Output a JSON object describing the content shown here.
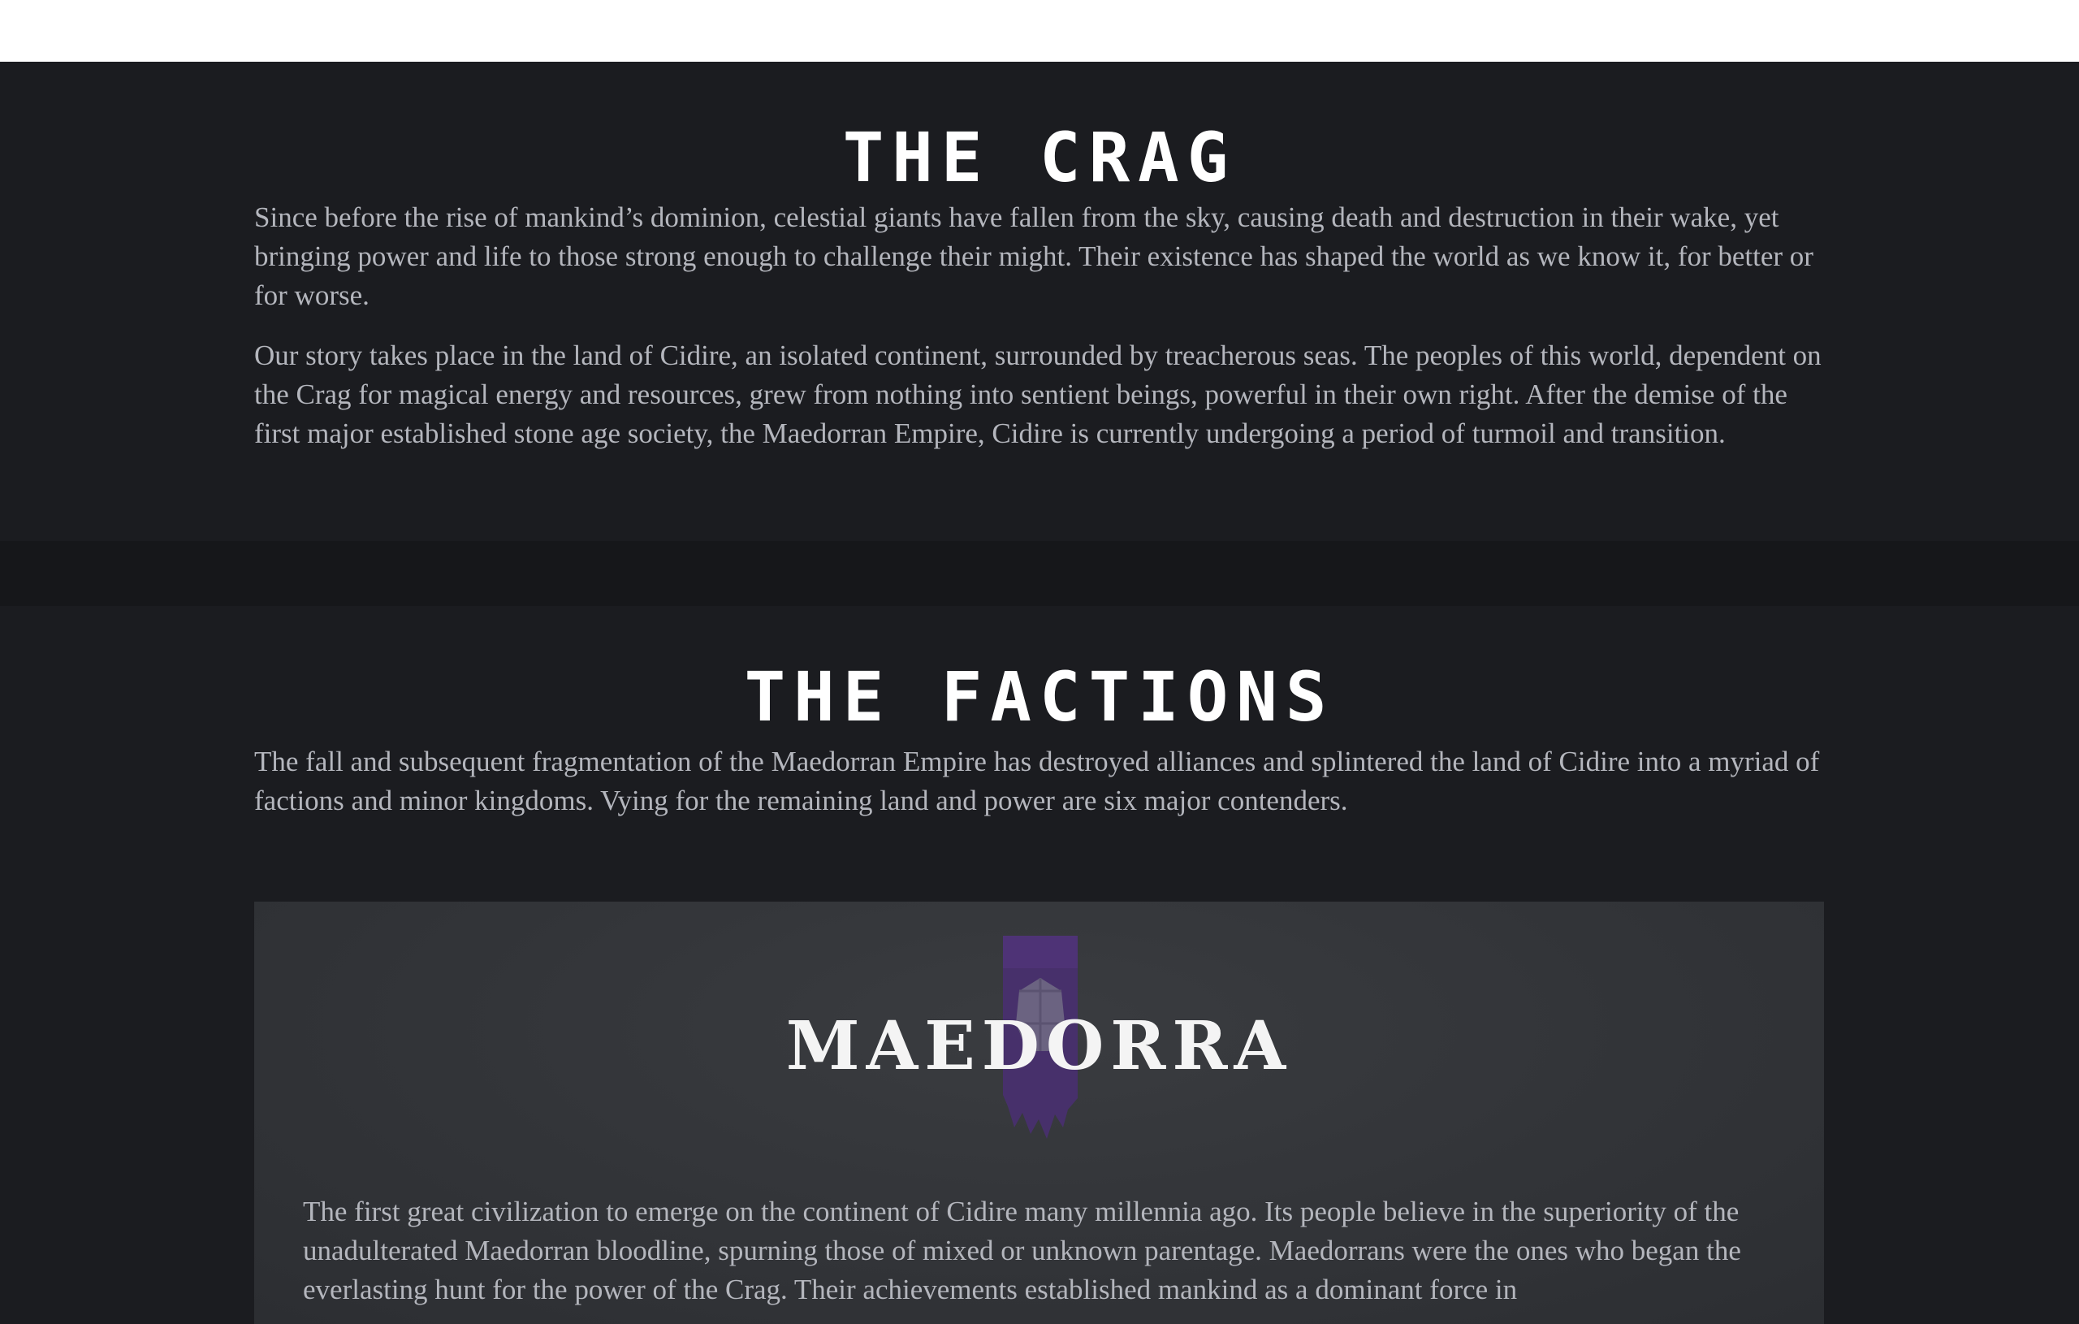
{
  "crag": {
    "title": "THE CRAG",
    "paragraphs": [
      "Since before the rise of mankind’s dominion, celestial giants have fallen from the sky, causing death and destruction in their wake, yet bringing power and life to those strong enough to challenge their might. Their existence has shaped the world as we know it, for better or for worse.",
      "Our story takes place in the land of Cidire, an isolated continent, surrounded by treacherous seas. The peoples of this world, dependent on the Crag for magical energy and resources, grew from nothing into sentient beings, powerful in their own right. After the demise of the first major established stone age society, the Maedorran Empire, Cidire is currently undergoing a period of turmoil and transition."
    ]
  },
  "factions": {
    "title": "THE FACTIONS",
    "intro": "The fall and subsequent fragmentation of the Maedorran Empire has destroyed alliances and splintered the land of Cidire into a myriad of factions and minor kingdoms. Vying for the remaining land and power are six major contenders.",
    "cards": [
      {
        "name": "MAEDORRA",
        "banner_icon": "crystal-banner-icon",
        "banner_color": "#5b3a8c",
        "description": "The first great civilization to emerge on the continent of Cidire many millennia ago. Its people believe in the superiority of the unadulterated Maedorran bloodline, spurning those of mixed or unknown parentage. Maedorrans were the ones who began the everlasting hunt for the power of the Crag. Their achievements established mankind as a dominant force in"
      }
    ]
  },
  "colors": {
    "page_bg": "#1b1c20",
    "band_bg": "#16171a",
    "card_bg": "#323438",
    "heading": "#ffffff",
    "body_text": "#b4b6bd"
  }
}
